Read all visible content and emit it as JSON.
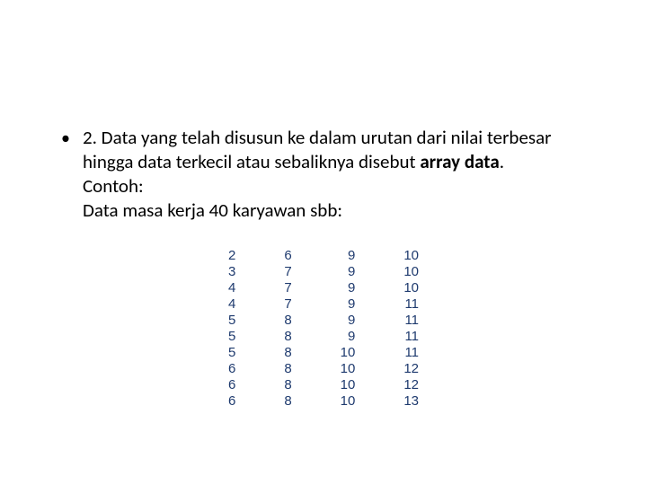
{
  "bullet": {
    "marker": "•",
    "line1_a": "2. Data yang telah disusun ke dalam urutan dari nilai terbesar",
    "line2_a": "hingga data terkecil atau sebaliknya disebut ",
    "line2_bold": "array data",
    "line2_b": ".",
    "line3": "Contoh:",
    "line4": "Data masa kerja 40 karyawan sbb:"
  },
  "columns": [
    [
      "2",
      "3",
      "4",
      "4",
      "5",
      "5",
      "5",
      "6",
      "6",
      "6"
    ],
    [
      "6",
      "7",
      "7",
      "7",
      "8",
      "8",
      "8",
      "8",
      "8",
      "8"
    ],
    [
      "9",
      "9",
      "9",
      "9",
      "9",
      "9",
      "10",
      "10",
      "10",
      "10"
    ],
    [
      "10",
      "10",
      "10",
      "11",
      "11",
      "11",
      "11",
      "12",
      "12",
      "13"
    ]
  ]
}
